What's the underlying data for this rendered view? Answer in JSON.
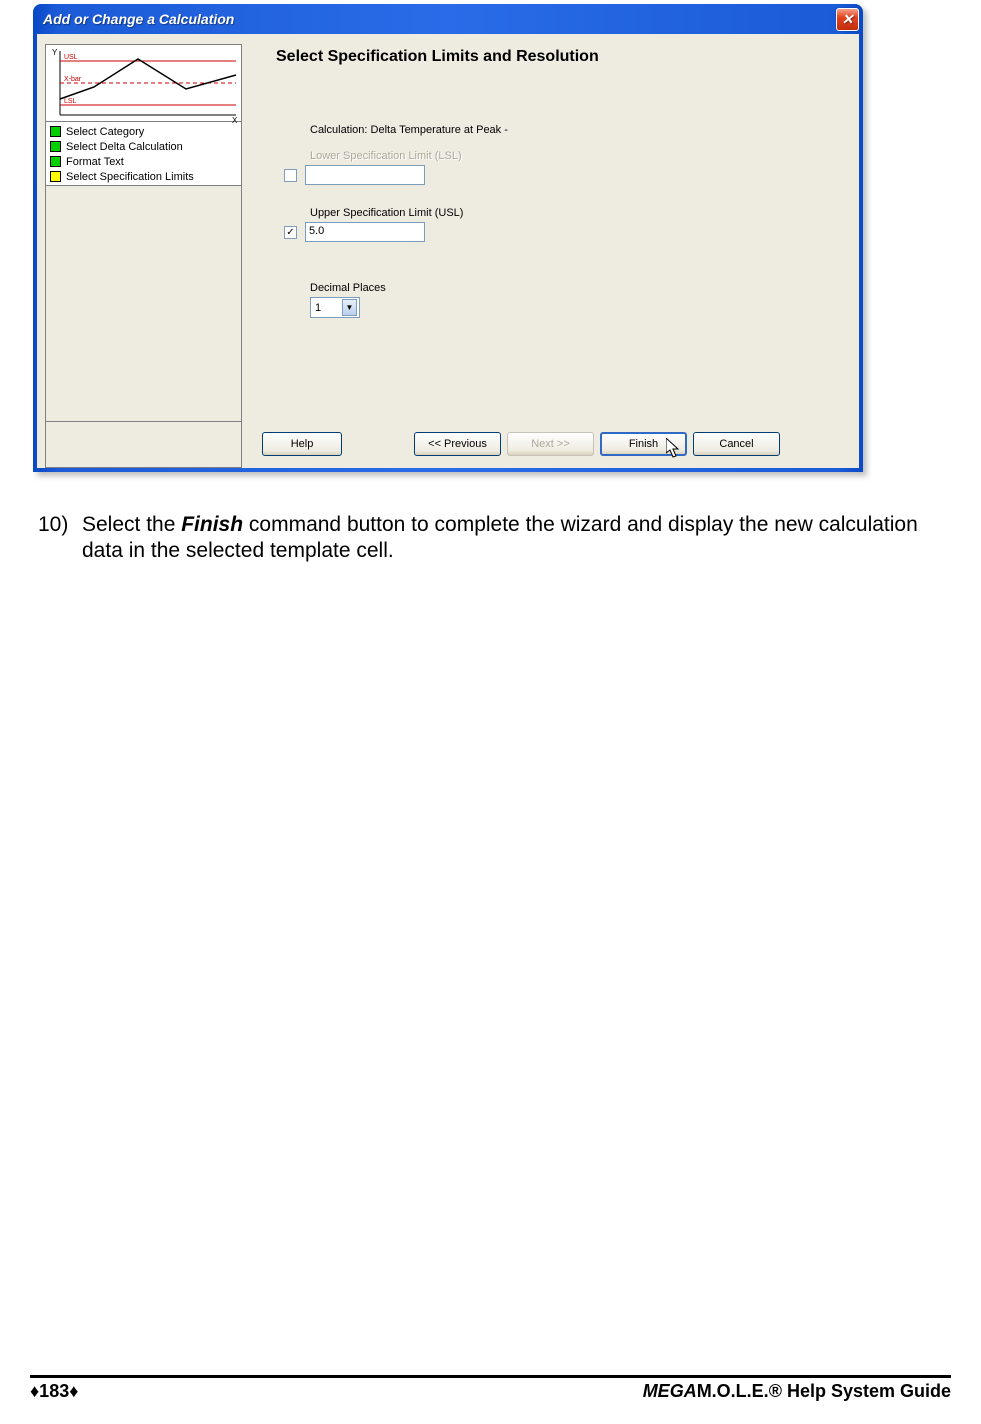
{
  "dialog": {
    "title": "Add or Change a Calculation",
    "close_glyph": "✕"
  },
  "chart": {
    "y_label": "Y",
    "x_label": "X",
    "usl": "USL",
    "xbar": "X-bar",
    "lsl": "LSL"
  },
  "steps": [
    {
      "color": "green",
      "label": "Select Category"
    },
    {
      "color": "green",
      "label": "Select Delta Calculation"
    },
    {
      "color": "green",
      "label": "Format Text"
    },
    {
      "color": "yellow",
      "label": "Select Specification Limits"
    }
  ],
  "panel": {
    "heading": "Select Specification Limits and Resolution",
    "calculation": "Calculation: Delta Temperature at Peak -",
    "lsl_label": "Lower Specification Limit (LSL)",
    "lsl_value": "",
    "usl_label": "Upper Specification Limit (USL)",
    "usl_value": "5.0",
    "decimal_label": "Decimal Places",
    "decimal_value": "1"
  },
  "buttons": {
    "help": "Help",
    "previous": "<< Previous",
    "next": "Next >>",
    "finish": "Finish",
    "cancel": "Cancel"
  },
  "instruction": {
    "number": "10)",
    "pre": "Select the ",
    "bold": "Finish",
    "post": " command button to complete the wizard and display the new calculation data in the selected template cell."
  },
  "footer": {
    "page": "♦183♦",
    "brand_italic": "MEGA",
    "brand_rest": "M.O.L.E.® Help System Guide"
  }
}
